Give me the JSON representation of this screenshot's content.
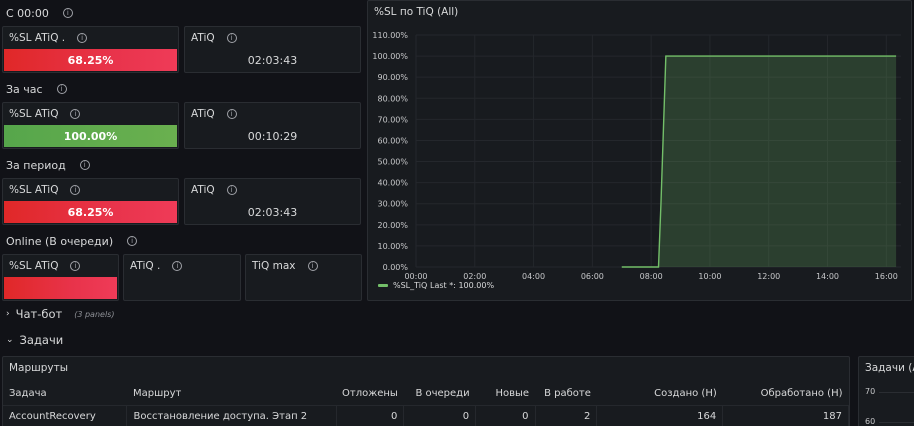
{
  "rows": {
    "r1": {
      "title": "С 00:00",
      "sl_label": "%SL ATiQ .",
      "sl_value": "68.25%",
      "atiq_label": "ATiQ",
      "atiq_value": "02:03:43"
    },
    "r2": {
      "title": "За час",
      "sl_label": "%SL ATiQ",
      "sl_value": "100.00%",
      "atiq_label": "ATiQ",
      "atiq_value": "00:10:29"
    },
    "r3": {
      "title": "За период",
      "sl_label": "%SL ATiQ",
      "sl_value": "68.25%",
      "atiq_label": "ATiQ",
      "atiq_value": "02:03:43"
    },
    "r4": {
      "title": "Online (В очереди)",
      "sl_label": "%SL ATiQ",
      "atiq_label": "ATiQ .",
      "tiq_label": "TiQ max"
    }
  },
  "colors": {
    "red": "#e02f44",
    "green": "#56a64b",
    "background": "#111217",
    "panel": "#181b1f"
  },
  "chart_panel": {
    "title": "%SL по TiQ (All)",
    "legend_value_label": "Last *: 100.00%"
  },
  "chart_data": {
    "type": "area",
    "x": [
      "07:00",
      "08:00",
      "08:15",
      "08:20",
      "08:30",
      "10:00",
      "12:00",
      "14:00",
      "16:00",
      "16:20"
    ],
    "series": [
      {
        "name": "%SL_TiQ",
        "values": [
          0,
          0,
          0,
          30,
          100,
          100,
          100,
          100,
          100,
          100
        ],
        "color": "#73bf69"
      }
    ],
    "y_ticks": [
      "0.00%",
      "10.00%",
      "20.00%",
      "30.00%",
      "40.00%",
      "50.00%",
      "60.00%",
      "70.00%",
      "80.00%",
      "90.00%",
      "100.00%",
      "110.00%"
    ],
    "x_ticks": [
      "00:00",
      "02:00",
      "04:00",
      "06:00",
      "08:00",
      "10:00",
      "12:00",
      "14:00",
      "16:00"
    ],
    "ylim": [
      0,
      110
    ],
    "xlim_hours": [
      0,
      16.5
    ],
    "grid": true,
    "legend": "bottom-left"
  },
  "sections": {
    "chatbot": {
      "label": "Чат-бот",
      "sub": "(3 panels)"
    },
    "tasks": {
      "label": "Задачи"
    }
  },
  "routes": {
    "title": "Маршруты",
    "headers": [
      "Задача",
      "Маршрут",
      "Отложены",
      "В очереди",
      "Новые",
      "В работе",
      "Создано (Н)",
      "Обработано (Н)"
    ],
    "rows": [
      [
        "AccountRecovery",
        "Восстановление доступа. Этап 2",
        "0",
        "0",
        "0",
        "2",
        "164",
        "187"
      ]
    ]
  },
  "tasks_panel": {
    "title": "Задачи (All)",
    "y_ticks": [
      "70",
      "60"
    ]
  }
}
